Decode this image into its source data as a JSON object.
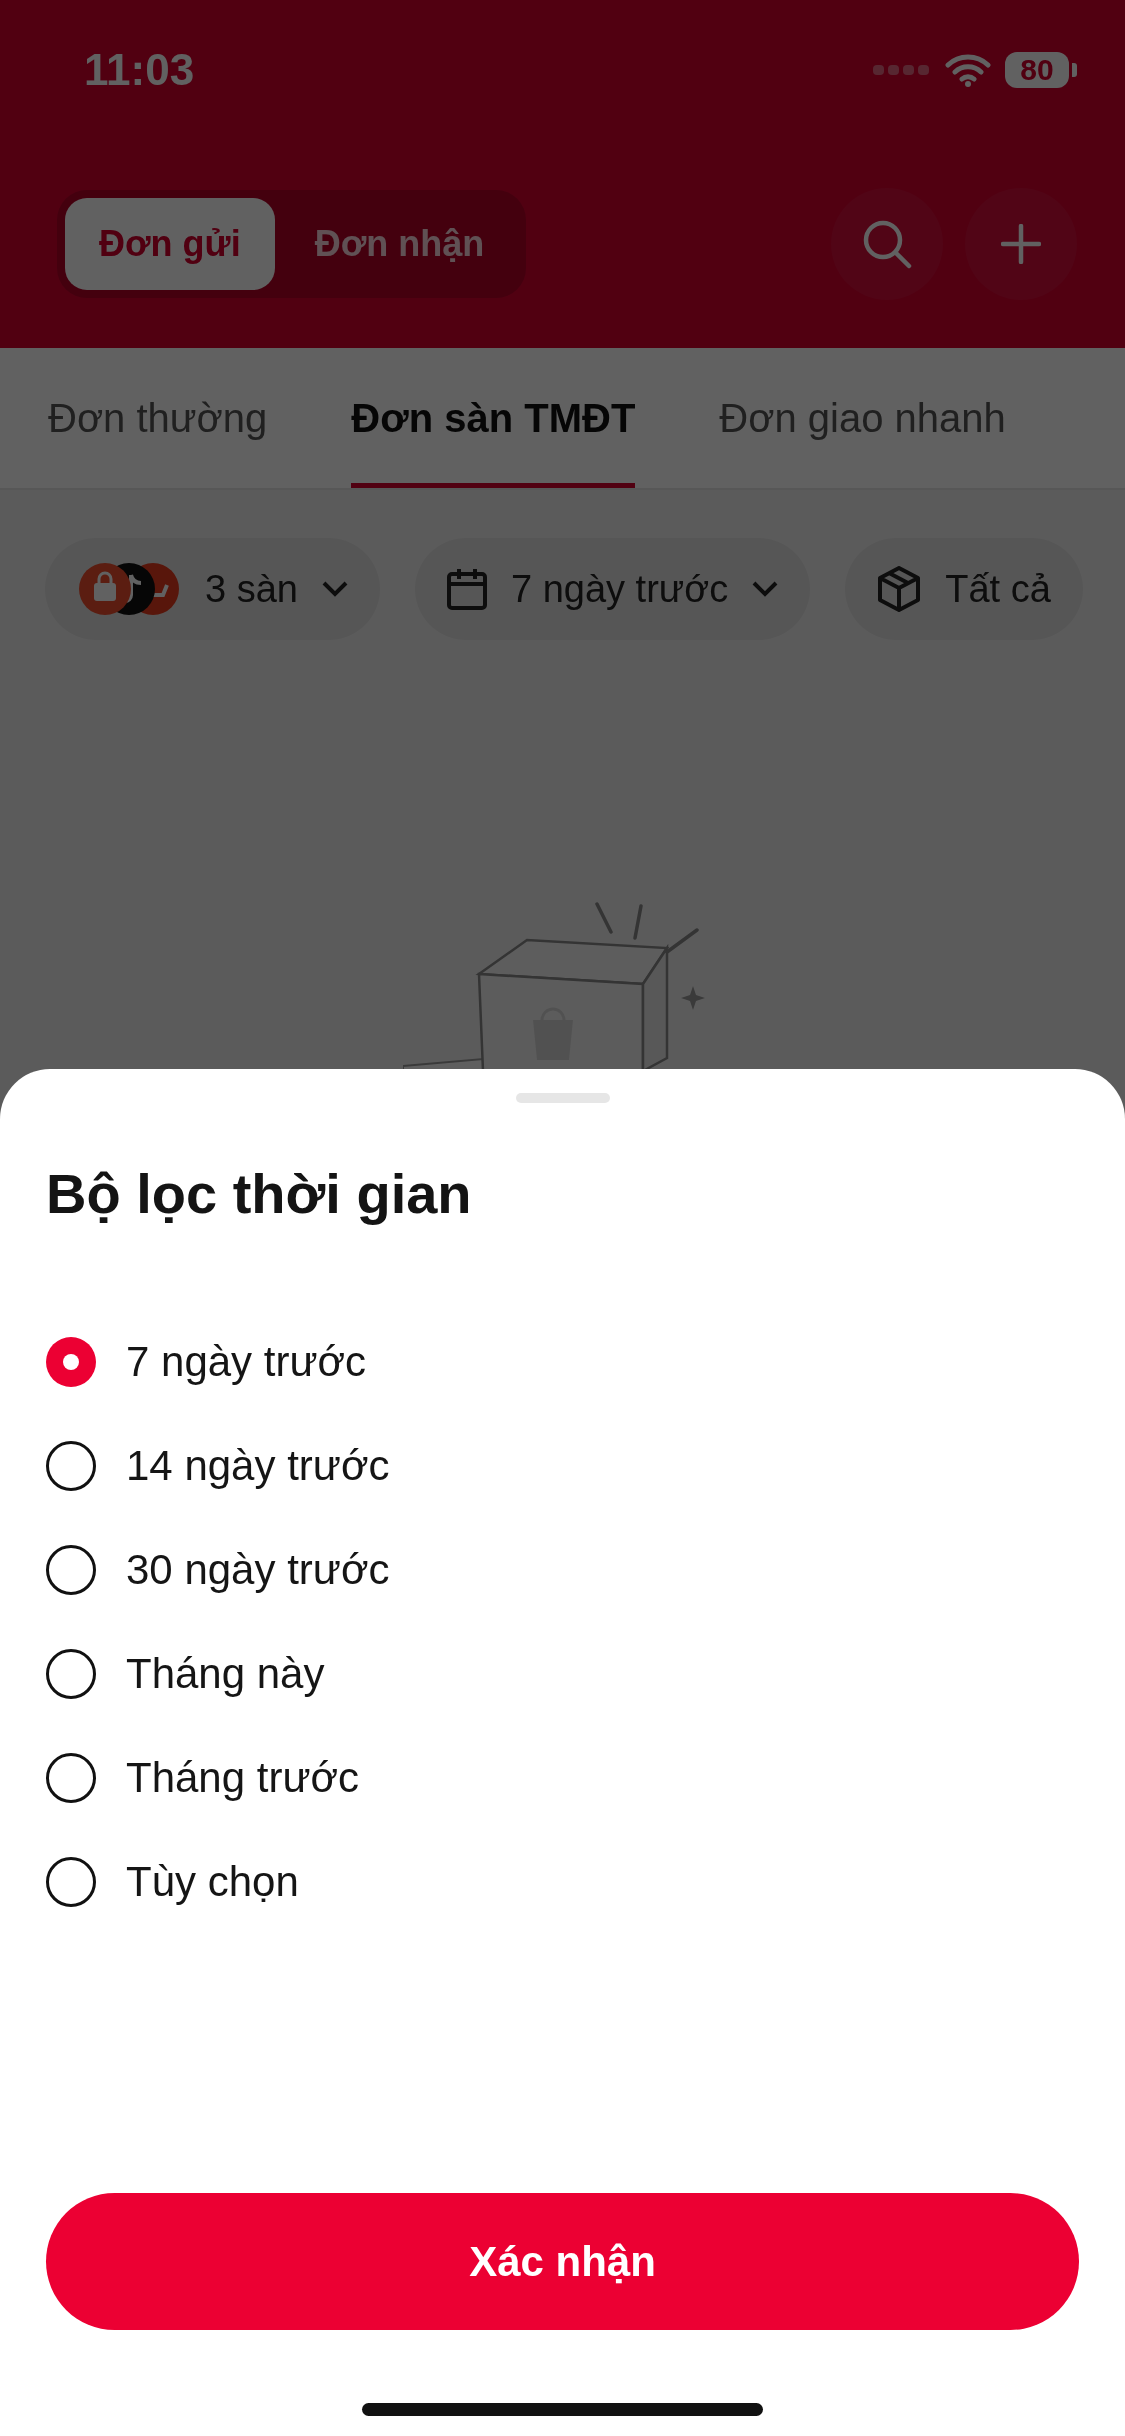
{
  "status_bar": {
    "time": "11:03",
    "battery": "80"
  },
  "segments": [
    {
      "label": "Đơn gửi",
      "selected": true
    },
    {
      "label": "Đơn nhận",
      "selected": false
    }
  ],
  "tabs": [
    {
      "label": "Đơn thường",
      "selected": false
    },
    {
      "label": "Đơn sàn TMĐT",
      "selected": true
    },
    {
      "label": "Đơn giao nhanh",
      "selected": false
    }
  ],
  "filters": [
    {
      "kind": "platforms",
      "label": "3 sàn"
    },
    {
      "kind": "date",
      "label": "7 ngày trước"
    },
    {
      "kind": "package",
      "label": "Tất cả"
    }
  ],
  "sheet": {
    "title": "Bộ lọc thời gian",
    "options": [
      {
        "label": "7 ngày trước",
        "selected": true
      },
      {
        "label": "14 ngày trước",
        "selected": false
      },
      {
        "label": "30 ngày trước",
        "selected": false
      },
      {
        "label": "Tháng này",
        "selected": false
      },
      {
        "label": "Tháng trước",
        "selected": false
      },
      {
        "label": "Tùy chọn",
        "selected": false
      }
    ],
    "confirm_button": "Xác nhận"
  }
}
